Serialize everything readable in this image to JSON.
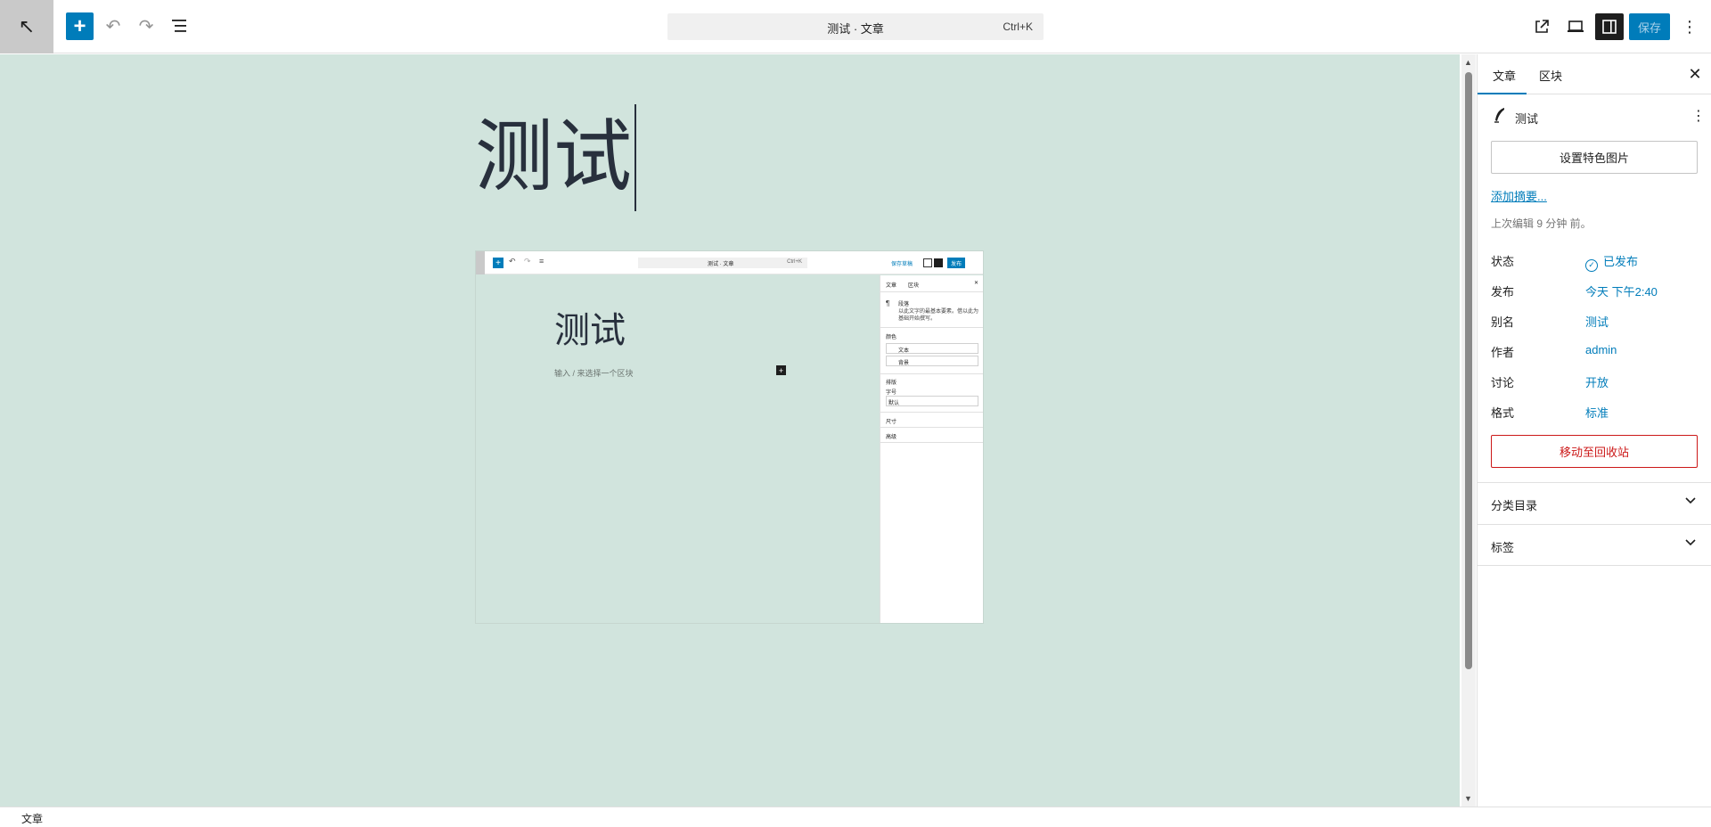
{
  "toolbar": {
    "back_icon": "↖",
    "add_icon": "+",
    "undo_icon": "↶",
    "redo_icon": "↷",
    "listview_icon": "≡",
    "document_title": "测试 · 文章",
    "shortcut": "Ctrl+K",
    "save_label": "保存",
    "more_icon": "⋮"
  },
  "canvas": {
    "post_title": "测试"
  },
  "embedded_screenshot": {
    "doc_title": "测试 · 文章",
    "shortcut": "Ctrl+K",
    "save_draft": "保存草稿",
    "publish": "发布",
    "title": "测试",
    "hint": "输入 / 来选择一个区块",
    "sidebar": {
      "tab_post": "文章",
      "tab_block": "区块",
      "block_name": "段落",
      "block_desc": "以此文字的最基本要素。借以此为基础开始撰写。",
      "color_label": "颜色",
      "text": "文本",
      "background": "背景",
      "typography": "排版",
      "font_size": "字号",
      "default": "默认",
      "dimensions": "尺寸",
      "advanced": "高级"
    }
  },
  "sidebar": {
    "tab_post": "文章",
    "tab_block": "区块",
    "close_icon": "✕",
    "post_name": "测试",
    "featured_image_button": "设置特色图片",
    "add_excerpt": "添加摘要...",
    "last_edited": "上次编辑 9 分钟 前。",
    "meta": [
      {
        "key": "状态",
        "value": "已发布"
      },
      {
        "key": "发布",
        "value": "今天 下午2:40"
      },
      {
        "key": "别名",
        "value": "测试"
      },
      {
        "key": "作者",
        "value": "admin"
      },
      {
        "key": "讨论",
        "value": "开放"
      },
      {
        "key": "格式",
        "value": "标准"
      }
    ],
    "trash_button": "移动至回收站",
    "panels": [
      {
        "label": "分类目录"
      },
      {
        "label": "标签"
      }
    ]
  },
  "footer": {
    "breadcrumb": "文章"
  },
  "colors": {
    "accent": "#007cba",
    "canvas_bg": "#d1e4dd",
    "danger": "#cc1818"
  }
}
